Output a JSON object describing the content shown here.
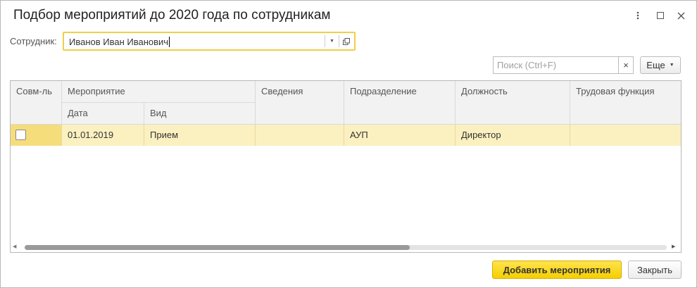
{
  "window": {
    "title": "Подбор мероприятий до 2020 года по сотрудникам",
    "controls": {
      "more_icon": "more-vertical-icon",
      "maximize_icon": "maximize-icon",
      "close_icon": "close-icon"
    }
  },
  "employee": {
    "label": "Сотрудник:",
    "value": "Иванов Иван Иванович",
    "border_color": "#f0cf4a"
  },
  "search": {
    "placeholder": "Поиск (Ctrl+F)",
    "value": "",
    "clear_glyph": "×"
  },
  "more_button": {
    "label": "Еще",
    "arrow": "▼"
  },
  "table": {
    "headers": {
      "combined": "Совм-ль",
      "event": "Мероприятие",
      "date": "Дата",
      "kind": "Вид",
      "info": "Сведения",
      "department": "Подразделение",
      "position": "Должность",
      "labor_function": "Трудовая функция"
    },
    "rows": [
      {
        "checked": false,
        "date": "01.01.2019",
        "kind": "Прием",
        "info": "",
        "department": "АУП",
        "position": "Директор",
        "labor_function": ""
      }
    ],
    "selected_row_color": "#fbf0c0",
    "horizontal_scroll_fraction": 0.6
  },
  "footer": {
    "add_label": "Добавить мероприятия",
    "close_label": "Закрыть",
    "accent_color": "#f5cf00"
  }
}
